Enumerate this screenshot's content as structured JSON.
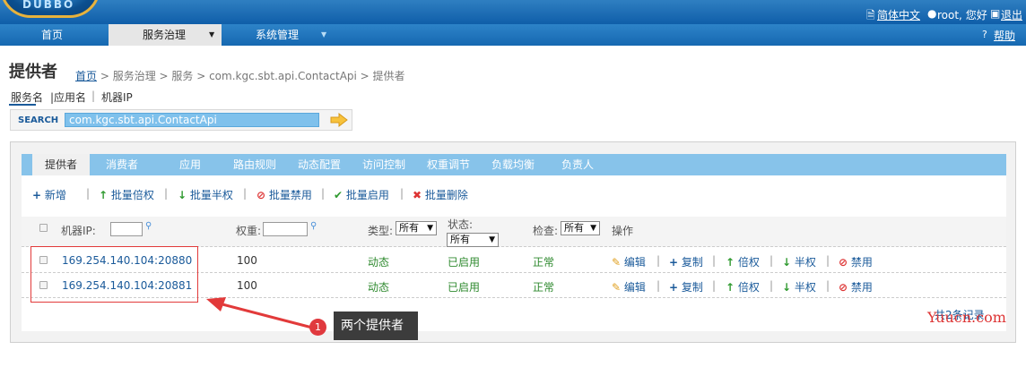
{
  "header": {
    "logo_text": "DUBBO",
    "language_label": "简体中文",
    "user_greeting": "root, 您好",
    "logout_label": "退出",
    "help_label": "帮助"
  },
  "nav": {
    "items": [
      {
        "label": "首页"
      },
      {
        "label": "服务治理"
      },
      {
        "label": "系统管理"
      }
    ]
  },
  "page": {
    "title": "提供者",
    "breadcrumb": {
      "home": "首页",
      "rest": "> 服务治理 > 服务 > com.kgc.sbt.api.ContactApi > 提供者"
    },
    "search_modes": [
      "服务名",
      "|应用名",
      "|",
      "机器IP"
    ],
    "search": {
      "label": "SEARCH",
      "value": "com.kgc.sbt.api.ContactApi"
    }
  },
  "tabs": [
    "提供者",
    "消费者",
    "应用",
    "路由规则",
    "动态配置",
    "访问控制",
    "权重调节",
    "负载均衡",
    "负责人"
  ],
  "actions": [
    "新增",
    "批量倍权",
    "批量半权",
    "批量禁用",
    "批量启用",
    "批量删除"
  ],
  "table": {
    "headers": {
      "ip": "机器IP:",
      "weight": "权重:",
      "type": "类型:",
      "status": "状态:",
      "check": "检查:",
      "ops": "操作"
    },
    "filters": {
      "type": "所有",
      "status": "所有",
      "check": "所有"
    },
    "rows": [
      {
        "ip": "169.254.140.104:20880",
        "weight": "100",
        "type": "动态",
        "status": "已启用",
        "check": "正常"
      },
      {
        "ip": "169.254.140.104:20881",
        "weight": "100",
        "type": "动态",
        "status": "已启用",
        "check": "正常"
      }
    ],
    "row_ops": [
      "编辑",
      "复制",
      "倍权",
      "半权",
      "禁用"
    ],
    "total": "共2条记录"
  },
  "annotation": {
    "number": "1",
    "text": "两个提供者"
  },
  "watermark": "Yuucn.com",
  "colors": {
    "accent": "#1a5a9a",
    "nav": "#1668b1",
    "tabbar": "#87c3ea",
    "annotation": "#e23a3a"
  }
}
